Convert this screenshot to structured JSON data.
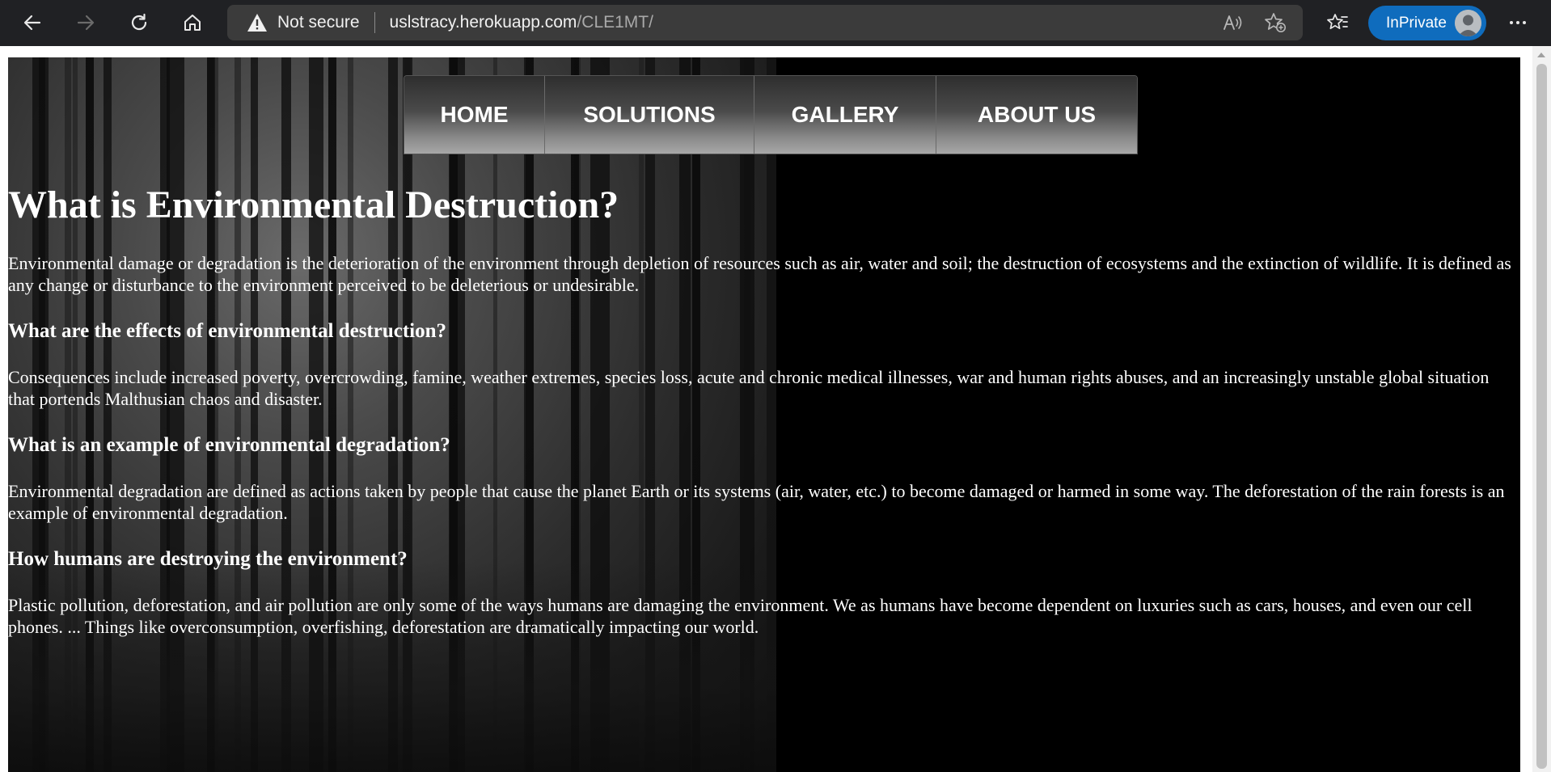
{
  "browser": {
    "not_secure_label": "Not secure",
    "url_host": "uslstracy.herokuapp.com",
    "url_path": "/CLE1MT/",
    "inprivate_label": "InPrivate",
    "icons": [
      "back-icon",
      "forward-icon",
      "refresh-icon",
      "home-icon",
      "warning-icon",
      "read-aloud-icon",
      "add-favorite-icon",
      "favorites-icon",
      "more-icon"
    ]
  },
  "menu": {
    "items": [
      {
        "label": "HOME"
      },
      {
        "label": "SOLUTIONS"
      },
      {
        "label": "GALLERY"
      },
      {
        "label": "ABOUT US"
      }
    ]
  },
  "content": {
    "title": "What is Environmental Destruction?",
    "intro": "Environmental damage or degradation is the deterioration of the environment through depletion of resources such as air, water and soil; the destruction of ecosystems and the extinction of wildlife. It is defined as any change or disturbance to the environment perceived to be deleterious or undesirable.",
    "sections": [
      {
        "heading": "What are the effects of environmental destruction?",
        "body": "Consequences include increased poverty, overcrowding, famine, weather extremes, species loss, acute and chronic medical illnesses, war and human rights abuses, and an increasingly unstable global situation that portends Malthusian chaos and disaster."
      },
      {
        "heading": "What is an example of environmental degradation?",
        "body": "Environmental degradation are defined as actions taken by people that cause the planet Earth or its systems (air, water, etc.) to become damaged or harmed in some way. The deforestation of the rain forests is an example of environmental degradation."
      },
      {
        "heading": "How humans are destroying the environment?",
        "body": "Plastic pollution, deforestation, and air pollution are only some of the ways humans are damaging the environment. We as humans have become dependent on luxuries such as cars, houses, and even our cell phones. ... Things like overconsumption, overfishing, deforestation are dramatically impacting our world."
      }
    ]
  },
  "colors": {
    "browser_bar": "#202124",
    "address_bar": "#3b3b3b",
    "inprivate": "#0f6cbd",
    "page_background": "#000000",
    "text": "#ffffff"
  }
}
